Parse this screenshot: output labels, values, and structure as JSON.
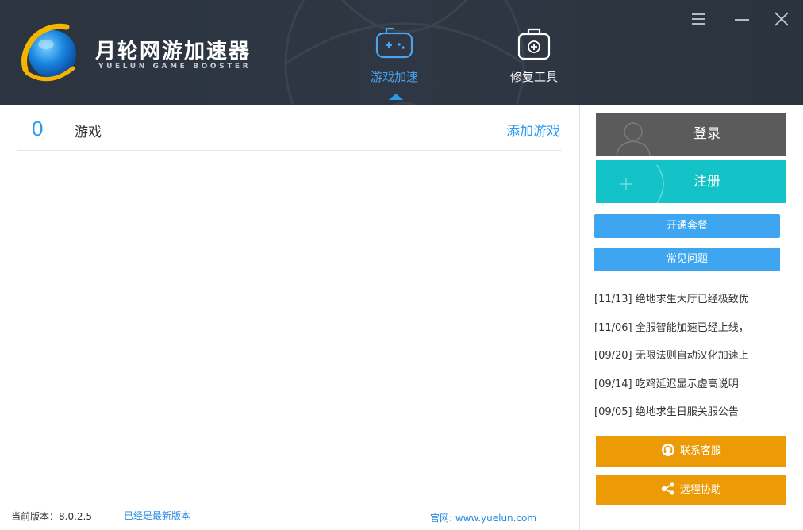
{
  "app": {
    "name_cn": "月轮网游加速器",
    "name_en": "YUELUN GAME BOOSTER"
  },
  "nav": {
    "tabs": [
      {
        "label": "游戏加速",
        "icon": "gamepad-icon",
        "active": true
      },
      {
        "label": "修复工具",
        "icon": "toolbox-icon",
        "active": false
      }
    ]
  },
  "window_controls": [
    "menu-icon",
    "minimize-icon",
    "close-icon"
  ],
  "games": {
    "count": "0",
    "title": "游戏",
    "add_label": "添加游戏"
  },
  "sidebar": {
    "login_label": "登录",
    "register_label": "注册",
    "package_label": "开通套餐",
    "faq_label": "常见问题",
    "news": [
      "[11/13] 绝地求生大厅已经极致优",
      "[11/06] 全服智能加速已经上线，",
      "[09/20] 无限法则自动汉化加速上",
      "[09/14] 吃鸡延迟显示虚高说明",
      "[09/05] 绝地求生日服关服公告"
    ],
    "support_label": "联系客服",
    "remote_label": "远程协助"
  },
  "footer": {
    "version_text": "当前版本：8.0.2.5",
    "latest_text": "已经是最新版本",
    "site_text": "官网: www.yuelun.com"
  },
  "colors": {
    "header_bg": "#2b3440",
    "accent_blue": "#2a9af0",
    "login_gray": "#5b5b5b",
    "register_teal": "#13c3c7",
    "button_blue": "#3ea6f0",
    "button_orange": "#ec9a06"
  }
}
